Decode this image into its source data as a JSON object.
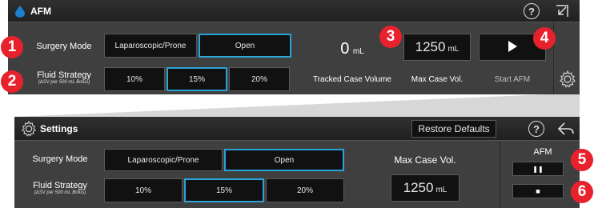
{
  "afm_panel": {
    "title": "AFM",
    "surgery_mode_label": "Surgery Mode",
    "surgery_mode_options": [
      "Laparoscopic/Prone",
      "Open"
    ],
    "fluid_strategy_label": "Fluid Strategy",
    "fluid_strategy_sub": "(ΔSV per 500 mL Bolus)",
    "fluid_strategy_options": [
      "10%",
      "15%",
      "20%"
    ],
    "tracked_volume_value": "0",
    "tracked_volume_unit": "mL",
    "tracked_volume_label": "Tracked Case Volume",
    "max_volume_value": "1250",
    "max_volume_unit": "mL",
    "max_volume_label": "Max Case Vol.",
    "start_label": "Start AFM",
    "help_icon": "?"
  },
  "settings_panel": {
    "title": "Settings",
    "restore_defaults_label": "Restore Defaults",
    "help_icon": "?",
    "surgery_mode_label": "Surgery Mode",
    "surgery_mode_options": [
      "Laparoscopic/Prone",
      "Open"
    ],
    "fluid_strategy_label": "Fluid Strategy",
    "fluid_strategy_sub": "(ΔSV per 500 mL Bolus)",
    "fluid_strategy_options": [
      "10%",
      "15%",
      "20%"
    ],
    "max_volume_label": "Max Case Vol.",
    "max_volume_value": "1250",
    "max_volume_unit": "mL",
    "afm_label": "AFM",
    "pause_symbol": "❚❚",
    "stop_symbol": "■"
  },
  "badges": [
    "1",
    "2",
    "3",
    "4",
    "5",
    "6"
  ],
  "colors": {
    "panel_bg": "#3f3f3f",
    "titlebar_bg": "#252525",
    "button_bg": "#111111",
    "selected_border": "#2aa3d6",
    "badge_red": "#e8222c",
    "drop_blue": "#1e7fd0"
  },
  "icons": [
    "water-drop-icon",
    "help-icon",
    "minimize-icon",
    "gear-icon",
    "back-arrow-icon",
    "play-icon",
    "pause-icon",
    "stop-icon"
  ]
}
